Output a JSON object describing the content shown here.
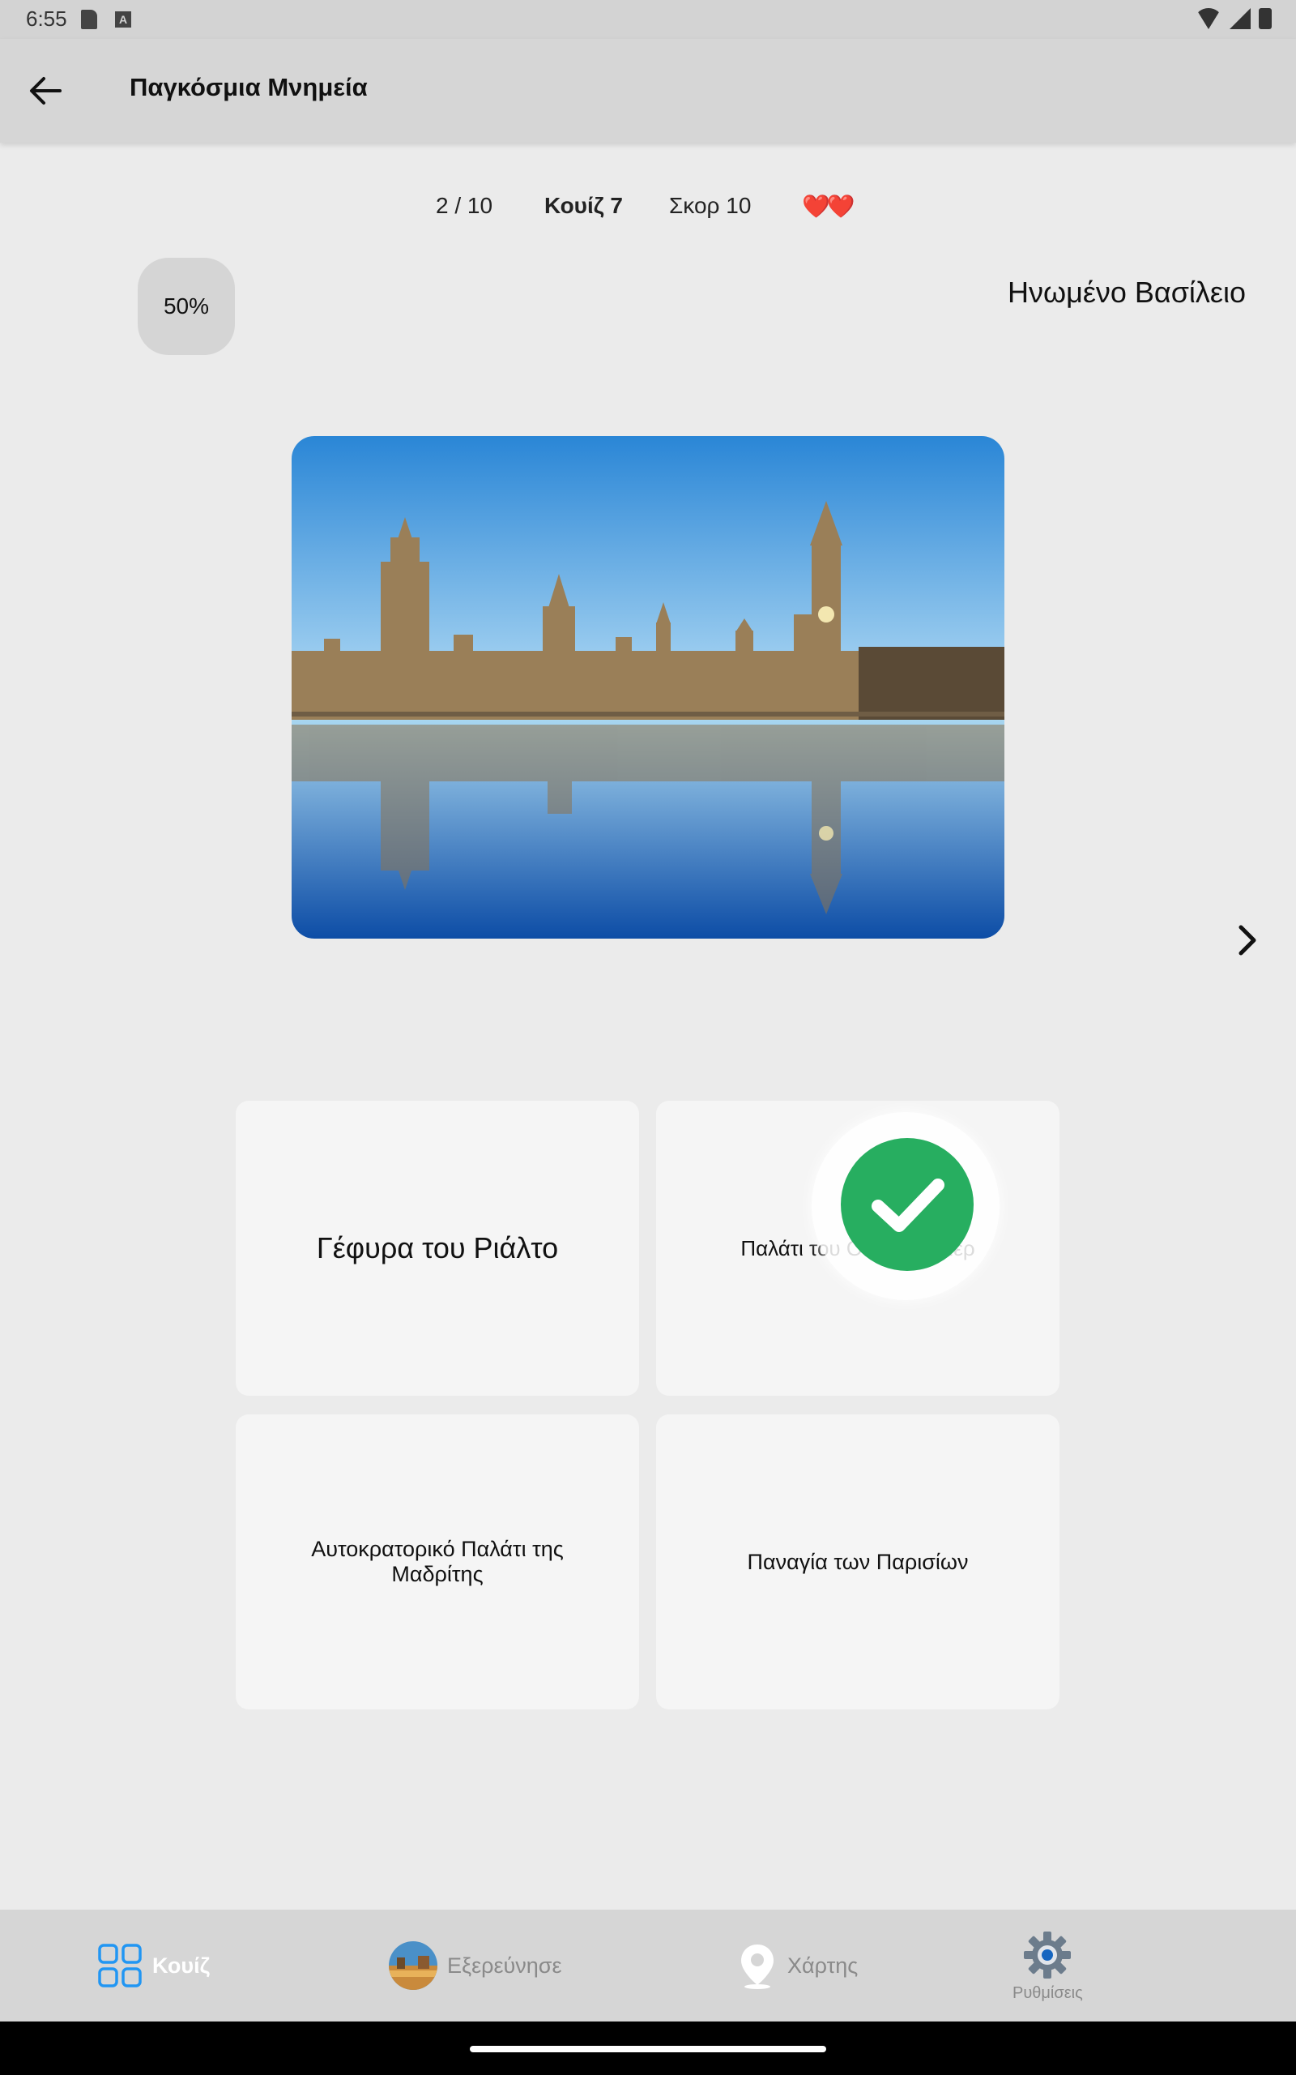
{
  "status_bar": {
    "time": "6:55"
  },
  "app_bar": {
    "title": "Παγκόσμια Μνημεία"
  },
  "quiz_info": {
    "progress": "2 / 10",
    "quiz": "Κουίζ 7",
    "score": "Σκορ 10",
    "lives": "❤️❤️"
  },
  "hint": {
    "percent": "50%"
  },
  "question": {
    "country": "Ηνωμένο Βασίλειο"
  },
  "answers": [
    {
      "label": "Γέφυρα του Ριάλτο"
    },
    {
      "label": "Παλάτι του Ουέστμινστερ",
      "state": "correct"
    },
    {
      "label": "Αυτοκρατορικό Παλάτι της Μαδρίτης"
    },
    {
      "label": "Παναγία των Παρισίων"
    }
  ],
  "bottom_nav": {
    "items": [
      {
        "label": "Κουίζ",
        "icon": "grid-icon",
        "active": true
      },
      {
        "label": "Εξερεύνησε",
        "icon": "globe-avatar-icon",
        "active": false
      },
      {
        "label": "Χάρτης",
        "icon": "map-pin-icon",
        "active": false
      },
      {
        "label": "Ρυθμίσεις",
        "icon": "gear-icon",
        "active": false
      }
    ]
  },
  "colors": {
    "accent": "#2196f3",
    "correct": "#27ae60",
    "lives": "#e53935",
    "app_bar": "#d6d6d6",
    "background": "#ebebeb"
  }
}
